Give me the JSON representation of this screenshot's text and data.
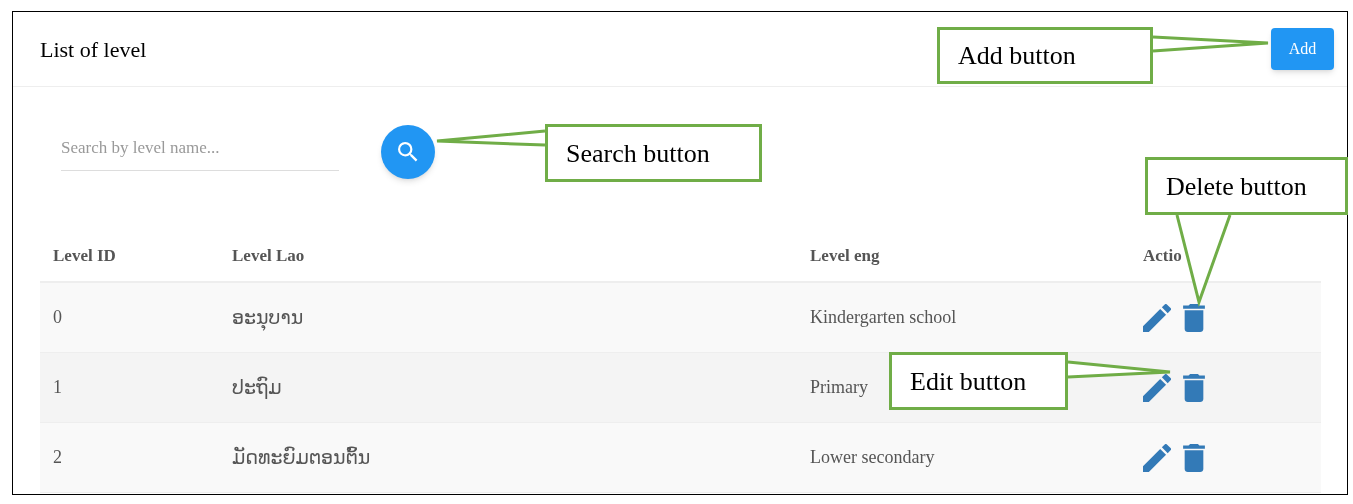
{
  "page": {
    "title": "List of level",
    "add_button": "Add"
  },
  "search": {
    "placeholder": "Search by level name..."
  },
  "table": {
    "columns": [
      "Level ID",
      "Level Lao",
      "Level eng",
      "Actio"
    ],
    "rows": [
      {
        "id": "0",
        "lao": "ອະນຸບານ",
        "eng": "Kindergarten school"
      },
      {
        "id": "1",
        "lao": "ປະຖົມ",
        "eng": "Primary"
      },
      {
        "id": "2",
        "lao": "ມັດທະຍົມຕອນຕົ້ນ",
        "eng": "Lower secondary"
      }
    ]
  },
  "callouts": [
    {
      "text": "Add button"
    },
    {
      "text": "Search button"
    },
    {
      "text": "Delete button"
    },
    {
      "text": "Edit button"
    }
  ]
}
